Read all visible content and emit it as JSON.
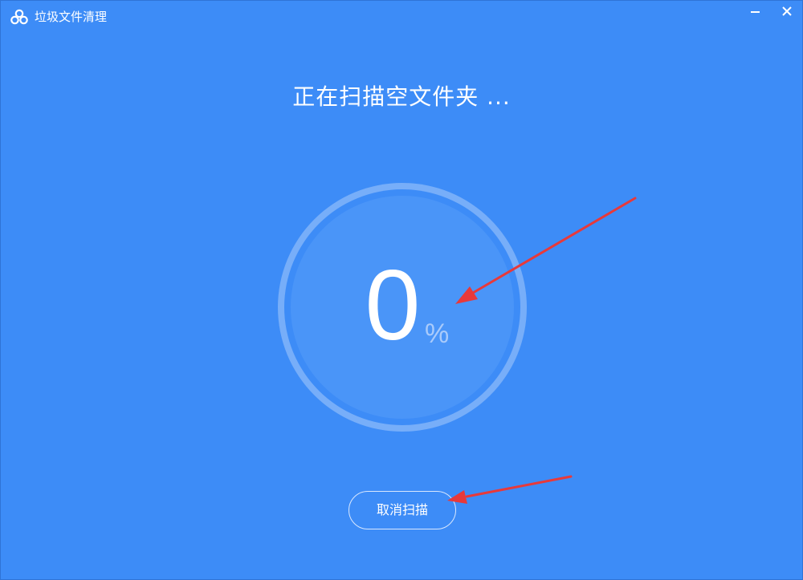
{
  "window": {
    "title": "垃圾文件清理",
    "controls": {
      "minimize_icon": "minimize-icon",
      "close_icon": "close-icon"
    }
  },
  "scan": {
    "status_text": "正在扫描空文件夹 ...",
    "progress_value": "0",
    "progress_unit": "%"
  },
  "actions": {
    "cancel_label": "取消扫描"
  },
  "colors": {
    "background": "#3d8cf7",
    "ring": "#8fbaf9",
    "inner_circle": "#4a95f8",
    "text": "#ffffff",
    "annotation_arrow": "#e8393a"
  }
}
